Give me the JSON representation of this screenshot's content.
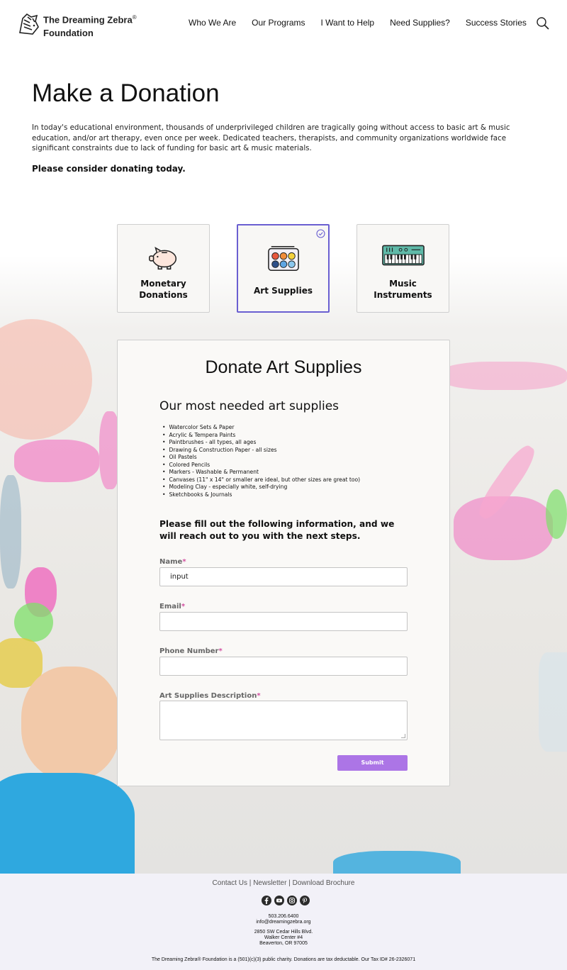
{
  "brand": {
    "name_line1": "The Dreaming Zebra",
    "reg": "®",
    "name_line2": "Foundation",
    "logo_icon": "zebra-head-icon"
  },
  "nav": {
    "items": [
      "Who We Are",
      "Our Programs",
      "I Want to Help",
      "Need Supplies?",
      "Success Stories"
    ],
    "search_icon": "search-icon"
  },
  "page": {
    "title": "Make a Donation",
    "intro": "In today's educational environment, thousands of underprivileged children are tragically going without access to basic art & music education, and/or art therapy, even once per week. Dedicated teachers, therapists, and community organizations worldwide face significant constraints due to lack of funding for basic art & music materials.",
    "cta": "Please consider donating today."
  },
  "options": [
    {
      "line1": "Monetary",
      "line2": "Donations",
      "icon": "piggy-bank-icon",
      "selected": false
    },
    {
      "line1": "Art Supplies",
      "line2": "",
      "icon": "paint-palette-icon",
      "selected": true
    },
    {
      "line1": "Music",
      "line2": "Instruments",
      "icon": "keyboard-icon",
      "selected": false
    }
  ],
  "form": {
    "title": "Donate Art Supplies",
    "needed_title": "Our most needed art supplies",
    "needed_items": [
      "Watercolor Sets & Paper",
      "Acrylic & Tempera Paints",
      "Paintbrushes - all types, all ages",
      "Drawing & Construction Paper - all sizes",
      "Oil Pastels",
      "Colored Pencils",
      "Markers - Washable & Permanent",
      "Canvases (11\" x 14\" or smaller are ideal, but other sizes are great too)",
      "Modeling Clay - especially white, self-drying",
      "Sketchbooks & Journals"
    ],
    "instructions": "Please fill out the following information, and we will reach out to you with the next steps.",
    "required_mark": "*",
    "fields": {
      "name_label": "Name",
      "name_value": "input",
      "email_label": "Email",
      "phone_label": "Phone Number",
      "description_label": "Art Supplies Description"
    },
    "submit_label": "Submit"
  },
  "footer": {
    "links": [
      "Contact Us",
      "Newsletter",
      "Download Brochure"
    ],
    "separator": "|",
    "socials": [
      "facebook-icon",
      "youtube-icon",
      "instagram-icon",
      "pinterest-icon"
    ],
    "phone": "503.206.6400",
    "email": "info@dreamingzebra.org",
    "address_line1": "2850 SW Cedar Hills Blvd.",
    "address_line2": "Walker Center #4",
    "address_line3": "Beaverton, OR 97005",
    "legal": "The Dreaming Zebra® Foundation is a (501)(c)(3) public charity. Donations are tax deductable. Our Tax ID# 26-2326071"
  },
  "colors": {
    "selected_border": "#6a5fd1",
    "required": "#d24fa0",
    "submit": "#ac75e6",
    "footer_bg": "#f2f1f8"
  }
}
